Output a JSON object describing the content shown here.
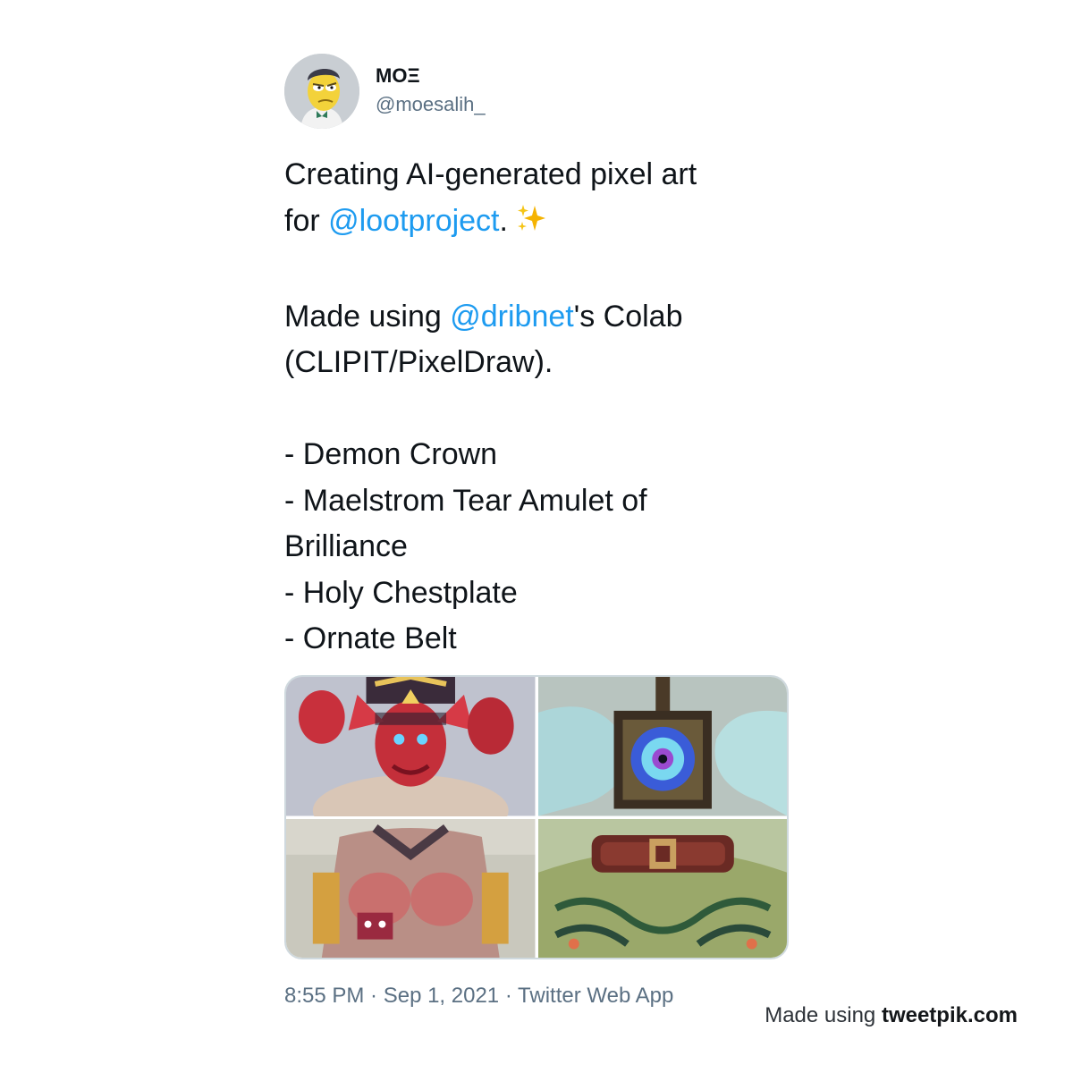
{
  "author": {
    "display_name": "MOΞ",
    "handle": "@moesalih_",
    "avatar_icon": "avatar-icon"
  },
  "tweet": {
    "line1": "Creating AI-generated pixel art",
    "line2_prefix": "for ",
    "mention1": "@lootproject",
    "line2_suffix": ".",
    "emoji_icon": "sparkles-icon",
    "line3_prefix": "Made using ",
    "mention2": "@dribnet",
    "line3_suffix": "'s Colab",
    "line4": "(CLIPIT/PixelDraw).",
    "items": [
      "- Demon Crown",
      "- Maelstrom Tear Amulet of",
      "Brilliance",
      "- Holy Chestplate",
      "- Ornate Belt"
    ]
  },
  "media": [
    {
      "name": "demon-crown-image"
    },
    {
      "name": "amulet-image"
    },
    {
      "name": "chestplate-image"
    },
    {
      "name": "belt-image"
    }
  ],
  "meta": {
    "timestamp": "8:55 PM · Sep 1, 2021 · Twitter Web App"
  },
  "footer": {
    "credit_prefix": "Made using ",
    "credit_brand": "tweetpik.com"
  },
  "colors": {
    "link": "#1d9bf0",
    "secondary_text": "#5b7083",
    "primary_text": "#0f1419"
  }
}
